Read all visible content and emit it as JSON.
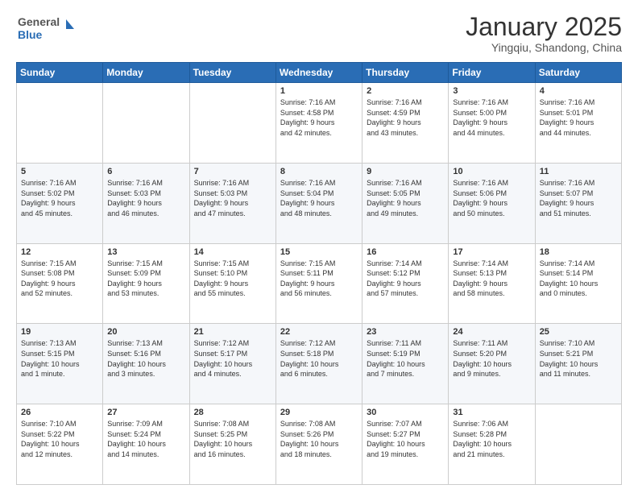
{
  "header": {
    "logo_line1": "General",
    "logo_line2": "Blue",
    "month": "January 2025",
    "location": "Yingqiu, Shandong, China"
  },
  "weekdays": [
    "Sunday",
    "Monday",
    "Tuesday",
    "Wednesday",
    "Thursday",
    "Friday",
    "Saturday"
  ],
  "weeks": [
    [
      {
        "day": "",
        "text": ""
      },
      {
        "day": "",
        "text": ""
      },
      {
        "day": "",
        "text": ""
      },
      {
        "day": "1",
        "text": "Sunrise: 7:16 AM\nSunset: 4:58 PM\nDaylight: 9 hours\nand 42 minutes."
      },
      {
        "day": "2",
        "text": "Sunrise: 7:16 AM\nSunset: 4:59 PM\nDaylight: 9 hours\nand 43 minutes."
      },
      {
        "day": "3",
        "text": "Sunrise: 7:16 AM\nSunset: 5:00 PM\nDaylight: 9 hours\nand 44 minutes."
      },
      {
        "day": "4",
        "text": "Sunrise: 7:16 AM\nSunset: 5:01 PM\nDaylight: 9 hours\nand 44 minutes."
      }
    ],
    [
      {
        "day": "5",
        "text": "Sunrise: 7:16 AM\nSunset: 5:02 PM\nDaylight: 9 hours\nand 45 minutes."
      },
      {
        "day": "6",
        "text": "Sunrise: 7:16 AM\nSunset: 5:03 PM\nDaylight: 9 hours\nand 46 minutes."
      },
      {
        "day": "7",
        "text": "Sunrise: 7:16 AM\nSunset: 5:03 PM\nDaylight: 9 hours\nand 47 minutes."
      },
      {
        "day": "8",
        "text": "Sunrise: 7:16 AM\nSunset: 5:04 PM\nDaylight: 9 hours\nand 48 minutes."
      },
      {
        "day": "9",
        "text": "Sunrise: 7:16 AM\nSunset: 5:05 PM\nDaylight: 9 hours\nand 49 minutes."
      },
      {
        "day": "10",
        "text": "Sunrise: 7:16 AM\nSunset: 5:06 PM\nDaylight: 9 hours\nand 50 minutes."
      },
      {
        "day": "11",
        "text": "Sunrise: 7:16 AM\nSunset: 5:07 PM\nDaylight: 9 hours\nand 51 minutes."
      }
    ],
    [
      {
        "day": "12",
        "text": "Sunrise: 7:15 AM\nSunset: 5:08 PM\nDaylight: 9 hours\nand 52 minutes."
      },
      {
        "day": "13",
        "text": "Sunrise: 7:15 AM\nSunset: 5:09 PM\nDaylight: 9 hours\nand 53 minutes."
      },
      {
        "day": "14",
        "text": "Sunrise: 7:15 AM\nSunset: 5:10 PM\nDaylight: 9 hours\nand 55 minutes."
      },
      {
        "day": "15",
        "text": "Sunrise: 7:15 AM\nSunset: 5:11 PM\nDaylight: 9 hours\nand 56 minutes."
      },
      {
        "day": "16",
        "text": "Sunrise: 7:14 AM\nSunset: 5:12 PM\nDaylight: 9 hours\nand 57 minutes."
      },
      {
        "day": "17",
        "text": "Sunrise: 7:14 AM\nSunset: 5:13 PM\nDaylight: 9 hours\nand 58 minutes."
      },
      {
        "day": "18",
        "text": "Sunrise: 7:14 AM\nSunset: 5:14 PM\nDaylight: 10 hours\nand 0 minutes."
      }
    ],
    [
      {
        "day": "19",
        "text": "Sunrise: 7:13 AM\nSunset: 5:15 PM\nDaylight: 10 hours\nand 1 minute."
      },
      {
        "day": "20",
        "text": "Sunrise: 7:13 AM\nSunset: 5:16 PM\nDaylight: 10 hours\nand 3 minutes."
      },
      {
        "day": "21",
        "text": "Sunrise: 7:12 AM\nSunset: 5:17 PM\nDaylight: 10 hours\nand 4 minutes."
      },
      {
        "day": "22",
        "text": "Sunrise: 7:12 AM\nSunset: 5:18 PM\nDaylight: 10 hours\nand 6 minutes."
      },
      {
        "day": "23",
        "text": "Sunrise: 7:11 AM\nSunset: 5:19 PM\nDaylight: 10 hours\nand 7 minutes."
      },
      {
        "day": "24",
        "text": "Sunrise: 7:11 AM\nSunset: 5:20 PM\nDaylight: 10 hours\nand 9 minutes."
      },
      {
        "day": "25",
        "text": "Sunrise: 7:10 AM\nSunset: 5:21 PM\nDaylight: 10 hours\nand 11 minutes."
      }
    ],
    [
      {
        "day": "26",
        "text": "Sunrise: 7:10 AM\nSunset: 5:22 PM\nDaylight: 10 hours\nand 12 minutes."
      },
      {
        "day": "27",
        "text": "Sunrise: 7:09 AM\nSunset: 5:24 PM\nDaylight: 10 hours\nand 14 minutes."
      },
      {
        "day": "28",
        "text": "Sunrise: 7:08 AM\nSunset: 5:25 PM\nDaylight: 10 hours\nand 16 minutes."
      },
      {
        "day": "29",
        "text": "Sunrise: 7:08 AM\nSunset: 5:26 PM\nDaylight: 10 hours\nand 18 minutes."
      },
      {
        "day": "30",
        "text": "Sunrise: 7:07 AM\nSunset: 5:27 PM\nDaylight: 10 hours\nand 19 minutes."
      },
      {
        "day": "31",
        "text": "Sunrise: 7:06 AM\nSunset: 5:28 PM\nDaylight: 10 hours\nand 21 minutes."
      },
      {
        "day": "",
        "text": ""
      }
    ]
  ]
}
